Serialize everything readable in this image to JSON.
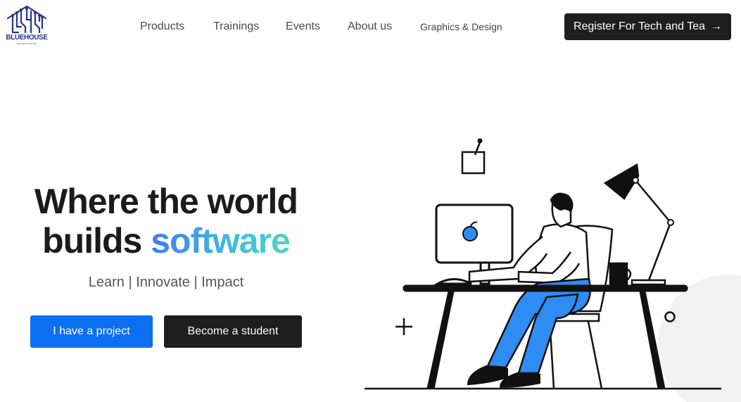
{
  "brand": {
    "name": "BLUEHOUSE",
    "tagline": "TECHNOLOGIES"
  },
  "nav": {
    "items": [
      {
        "label": "Products"
      },
      {
        "label": "Trainings"
      },
      {
        "label": "Events"
      },
      {
        "label": "About us"
      },
      {
        "label": "Graphics & Design"
      }
    ]
  },
  "cta": {
    "register_label": "Register For Tech and Tea",
    "arrow": "→"
  },
  "hero": {
    "title_line1": "Where the world",
    "title_line2_prefix": "builds ",
    "title_line2_accent": "software",
    "subtitle": "Learn | Innovate | Impact",
    "project_button": "I have a project",
    "student_button": "Become a student"
  },
  "colors": {
    "primary_blue": "#0c6ff2",
    "dark": "#1e1e1e",
    "accent_gradient_start": "#3f7cf0",
    "accent_gradient_end": "#4ed4c8",
    "logo_blue": "#27338a",
    "illustration_blue": "#2f8cf2"
  },
  "icons": {
    "logo": "circuit-house-icon",
    "arrow": "arrow-right-icon",
    "fruit": "orange-fruit-icon"
  }
}
